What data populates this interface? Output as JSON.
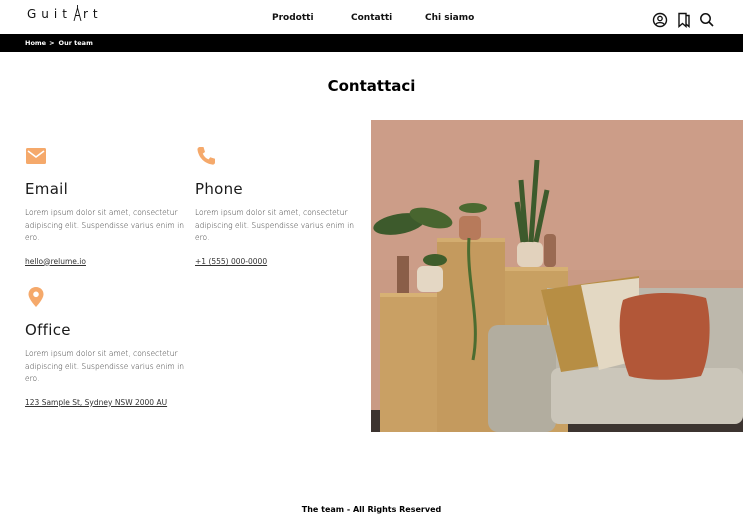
{
  "header": {
    "logo_left": "Guit",
    "logo_right": "rt",
    "nav": [
      {
        "label": "Prodotti"
      },
      {
        "label": "Contatti"
      },
      {
        "label": "Chi siamo"
      }
    ]
  },
  "breadcrumb": {
    "items": [
      "Home",
      "Our team"
    ],
    "separator": ">"
  },
  "main": {
    "title": "Contattaci",
    "accent_color": "#f5a96b",
    "cards": [
      {
        "icon": "envelope-icon",
        "heading": "Email",
        "body": "Lorem ipsum dolor sit amet, consectetur adipiscing elit. Suspendisse varius enim in ero.",
        "link": "hello@relume.io"
      },
      {
        "icon": "phone-icon",
        "heading": "Phone",
        "body": "Lorem ipsum dolor sit amet, consectetur adipiscing elit. Suspendisse varius enim in ero.",
        "link": "+1 (555) 000-0000"
      },
      {
        "icon": "map-pin-icon",
        "heading": "Office",
        "body": "Lorem ipsum dolor sit amet, consectetur adipiscing elit. Suspendisse varius enim in ero.",
        "link": "123 Sample St, Sydney NSW 2000 AU"
      }
    ]
  },
  "footer": {
    "text": "The team - All Rights Reserved"
  }
}
